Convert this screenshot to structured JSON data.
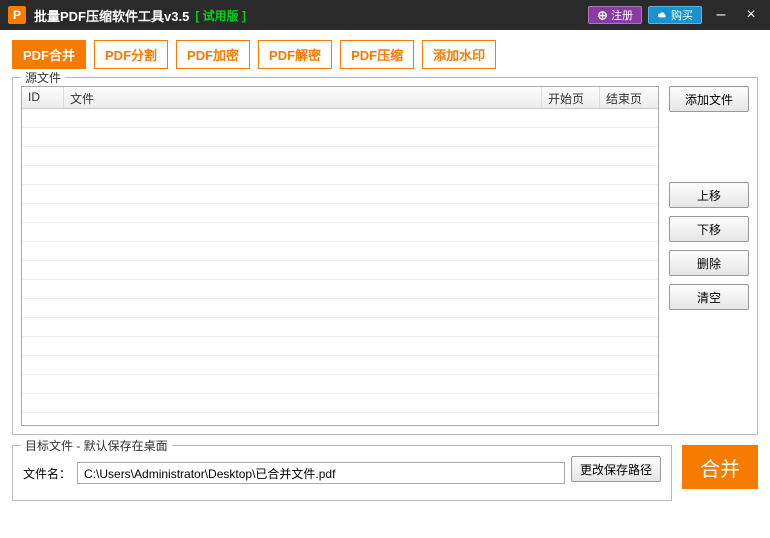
{
  "titlebar": {
    "app_icon_letter": "P",
    "title": "批量PDF压缩软件工具v3.5",
    "trial": "[ 试用版 ]",
    "register_label": "注册",
    "buy_label": "购买"
  },
  "tabs": [
    {
      "label": "PDF合并",
      "active": true
    },
    {
      "label": "PDF分割",
      "active": false
    },
    {
      "label": "PDF加密",
      "active": false
    },
    {
      "label": "PDF解密",
      "active": false
    },
    {
      "label": "PDF压缩",
      "active": false
    },
    {
      "label": "添加水印",
      "active": false
    }
  ],
  "source": {
    "legend": "源文件",
    "columns": {
      "id": "ID",
      "file": "文件",
      "start": "开始页",
      "end": "结束页"
    },
    "rows": [],
    "buttons": {
      "add": "添加文件",
      "up": "上移",
      "down": "下移",
      "delete": "删除",
      "clear": "清空"
    }
  },
  "target": {
    "legend": "目标文件 - 默认保存在桌面",
    "filename_label": "文件名：",
    "path": "C:\\Users\\Administrator\\Desktop\\已合并文件.pdf",
    "change_label": "更改保存路径",
    "merge_label": "合并"
  }
}
